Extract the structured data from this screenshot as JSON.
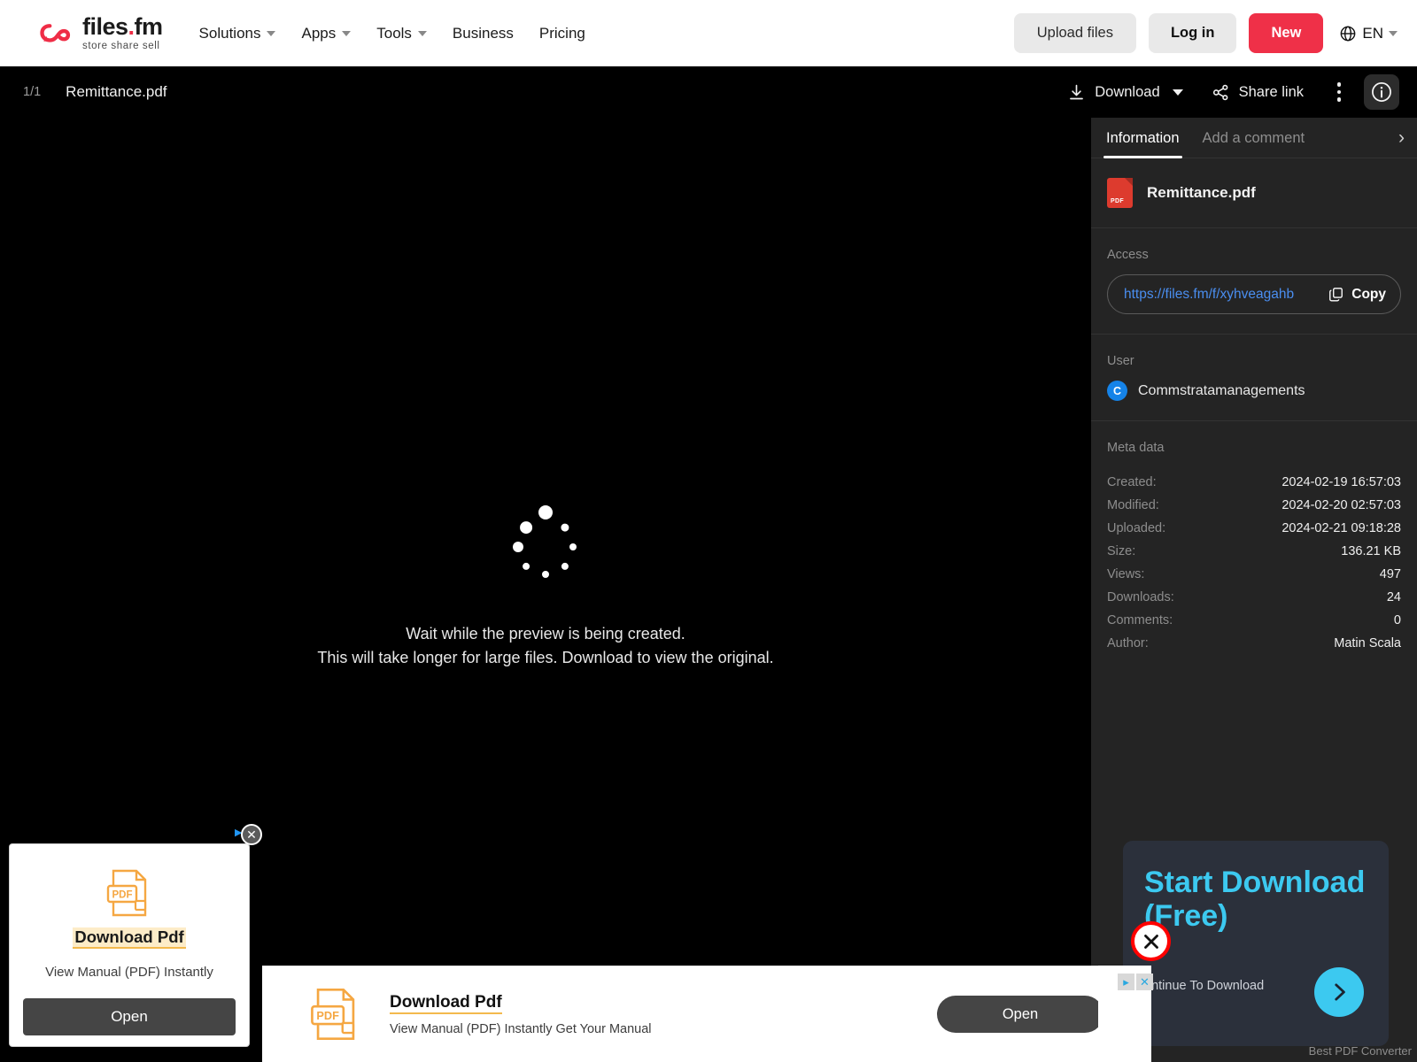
{
  "header": {
    "logo": {
      "main": "files",
      "dot": ".",
      "domain": "fm",
      "tagline": "store  share  sell"
    },
    "nav": [
      {
        "label": "Solutions",
        "has_caret": true
      },
      {
        "label": "Apps",
        "has_caret": true
      },
      {
        "label": "Tools",
        "has_caret": true
      },
      {
        "label": "Business",
        "has_caret": false
      },
      {
        "label": "Pricing",
        "has_caret": false
      }
    ],
    "upload_label": "Upload files",
    "login_label": "Log in",
    "new_label": "New",
    "language": "EN"
  },
  "filebar": {
    "page_count": "1/1",
    "file_name": "Remittance.pdf",
    "download_label": "Download",
    "share_label": "Share link"
  },
  "viewer": {
    "line1": "Wait while the preview is being created.",
    "line2": "This will take longer for large files. Download to view the original."
  },
  "sidebar": {
    "tabs": [
      {
        "label": "Information",
        "active": true
      },
      {
        "label": "Add a comment",
        "active": false
      }
    ],
    "file_name": "Remittance.pdf",
    "file_badge": "PDF",
    "access_label": "Access",
    "access_url": "https://files.fm/f/xyhveagahb",
    "copy_label": "Copy",
    "user_label": "User",
    "user_initial": "C",
    "user_name": "Commstratamanagements",
    "meta_label": "Meta data",
    "meta": [
      {
        "key": "Created:",
        "value": "2024-02-19 16:57:03"
      },
      {
        "key": "Modified:",
        "value": "2024-02-20 02:57:03"
      },
      {
        "key": "Uploaded:",
        "value": "2024-02-21 09:18:28"
      },
      {
        "key": "Size:",
        "value": "136.21 KB"
      },
      {
        "key": "Views:",
        "value": "497"
      },
      {
        "key": "Downloads:",
        "value": "24"
      },
      {
        "key": "Comments:",
        "value": "0"
      },
      {
        "key": "Author:",
        "value": "Matin Scala"
      }
    ]
  },
  "ads": {
    "left": {
      "title": "Download Pdf",
      "subtitle": "View Manual (PDF) Instantly",
      "button": "Open",
      "close": "✕"
    },
    "banner": {
      "title": "Download Pdf",
      "subtitle": "View Manual (PDF) Instantly Get Your Manual",
      "button": "Open"
    },
    "right": {
      "title": "Start Download (Free)",
      "subtitle": "ontinue To Download",
      "close": "✕",
      "footnote": "Best PDF Converter"
    }
  },
  "colors": {
    "brand_red": "#ef3048",
    "accent_blue": "#4a8ef0",
    "ad_cyan": "#3cc9f0",
    "sidebar_bg": "#242424"
  }
}
